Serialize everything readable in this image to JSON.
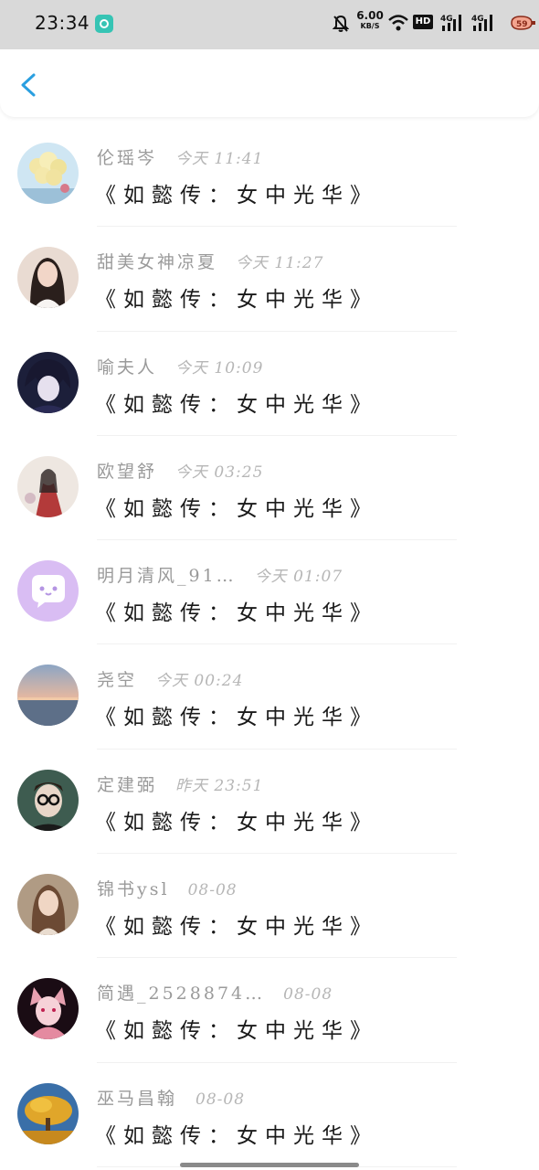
{
  "status_bar": {
    "time": "23:34",
    "net_speed_value": "6.00",
    "net_speed_unit": "KB/S",
    "hd_label": "HD",
    "network_1": "4G",
    "network_2": "4G",
    "battery_level": "59"
  },
  "header": {
    "back_icon": "chevron-left-icon",
    "accent_color": "#2a9fe0"
  },
  "items": [
    {
      "name": "伦瑶岑",
      "time": "今天 11:41",
      "message": "《如懿传：女中光华》",
      "avatar": "balloons"
    },
    {
      "name": "甜美女神凉夏",
      "time": "今天 11:27",
      "message": "《如懿传：女中光华》",
      "avatar": "girl-portrait"
    },
    {
      "name": "喻夫人",
      "time": "今天 10:09",
      "message": "《如懿传：女中光华》",
      "avatar": "anime-boy"
    },
    {
      "name": "欧望舒",
      "time": "今天 03:25",
      "message": "《如懿传：女中光华》",
      "avatar": "painted-figure"
    },
    {
      "name": "明月清风_91…",
      "time": "今天 01:07",
      "message": "《如懿传：女中光华》",
      "avatar": "default-chat-bubble"
    },
    {
      "name": "尧空",
      "time": "今天 00:24",
      "message": "《如懿传：女中光华》",
      "avatar": "sea-sunset"
    },
    {
      "name": "定建弼",
      "time": "昨天 23:51",
      "message": "《如懿传：女中光华》",
      "avatar": "man-glasses"
    },
    {
      "name": "锦书ysl",
      "time": "08-08",
      "message": "《如懿传：女中光华》",
      "avatar": "woman-portrait"
    },
    {
      "name": "简遇_2528874…",
      "time": "08-08",
      "message": "《如懿传：女中光华》",
      "avatar": "anime-pink-fox"
    },
    {
      "name": "巫马昌翰",
      "time": "08-08",
      "message": "《如懿传：女中光华》",
      "avatar": "golden-tree"
    }
  ]
}
